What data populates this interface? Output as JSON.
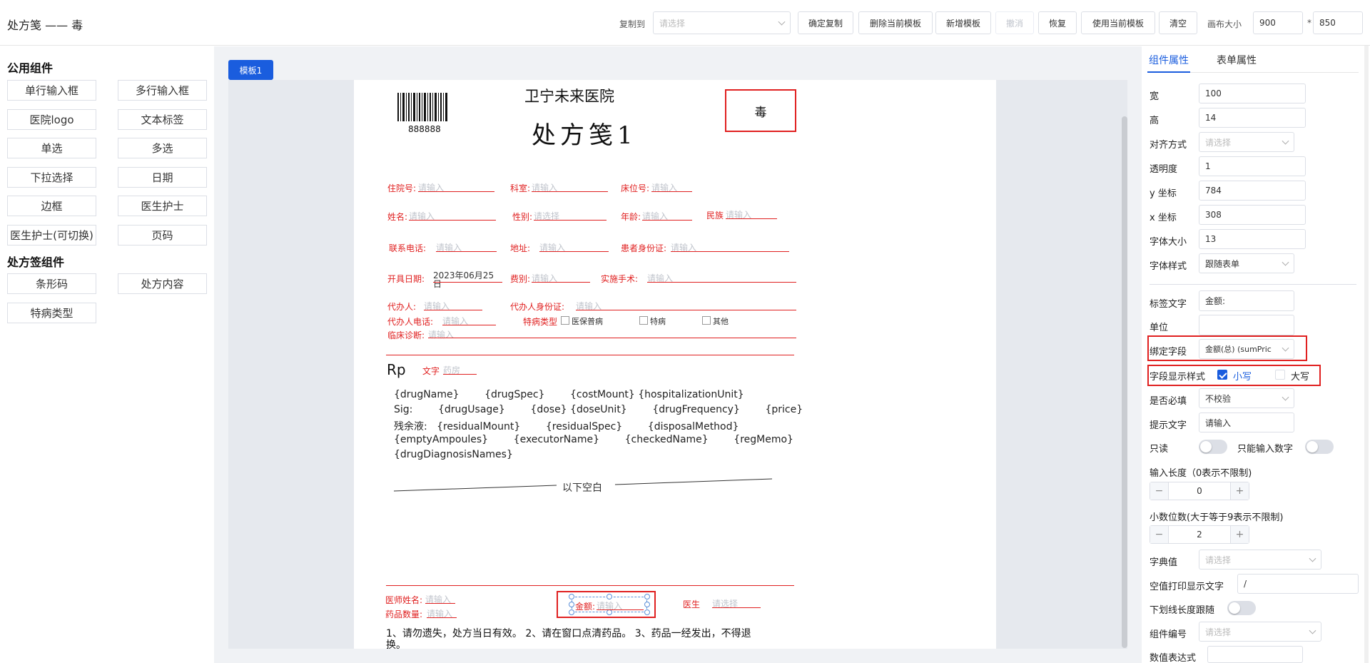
{
  "header": {
    "title": "处方笺 —— 毒",
    "copy_to_label": "复制到",
    "copy_to_placeholder": "请选择",
    "buttons": {
      "confirm_copy": "确定复制",
      "delete_template": "删除当前模板",
      "add_template": "新增模板",
      "undo": "撤消",
      "redo": "恢复",
      "use_template": "使用当前模板",
      "clear": "清空"
    },
    "canvas_size_label": "画布大小",
    "canvas_width": "900",
    "canvas_times": "*",
    "canvas_height": "850"
  },
  "left": {
    "public_title": "公用组件",
    "public_items": [
      "单行输入框",
      "多行输入框",
      "医院logo",
      "文本标签",
      "单选",
      "多选",
      "下拉选择",
      "日期",
      "边框",
      "医生护士",
      "医生护士(可切换)",
      "页码"
    ],
    "rx_title": "处方签组件",
    "rx_items": [
      "条形码",
      "处方内容",
      "特病类型"
    ]
  },
  "center": {
    "template_tab": "模板1",
    "hospital": "卫宁未来医院",
    "rx_title": "处方笺1",
    "barcode_number": "888888",
    "poison_label": "毒",
    "placeholder": "请输入",
    "select_placeholder": "请选择",
    "fields": {
      "inpatient_no": "住院号:",
      "department": "科室:",
      "bed_no": "床位号:",
      "name": "姓名:",
      "gender": "性别:",
      "age": "年龄:",
      "ethnicity": "民族",
      "phone": "联系电话:",
      "address": "地址:",
      "id_card": "患者身份证:",
      "open_date": "开具日期:",
      "open_date_value": "2023年06月25日",
      "fee_type": "费别:",
      "surgery": "实施手术:",
      "agent": "代办人:",
      "agent_id": "代办人身份证:",
      "agent_phone": "代办人电话:",
      "disease_type": "特病类型",
      "diagnosis": "临床诊断:",
      "rp": "Rp",
      "text_label": "文字",
      "text_value": "药房",
      "doctor_name": "医师姓名:",
      "drug_qty": "药品数量:",
      "amount": "金额:",
      "doctor": "医生"
    },
    "disease_options": [
      "医保普病",
      "特病",
      "其他"
    ],
    "rx_lines": [
      "{drugName}        {drugSpec}        {costMount} {hospitalizationUnit}",
      "Sig:        {drugUsage}        {dose} {doseUnit}        {drugFrequency}        {price}",
      "残余液:   {residualMount}        {residualSpec}        {disposalMethod}",
      "{emptyAmpoules}        {executorName}        {checkedName}        {regMemo}",
      "{drugDiagnosisNames}"
    ],
    "blank_text": "以下空白",
    "notice_line1": "1、请勿遗失，处方当日有效。 2、请在窗口点清药品。 3、药品一经发出，不得退",
    "notice_line2": "换。"
  },
  "right": {
    "tabs": [
      "组件属性",
      "表单属性"
    ],
    "labels": {
      "width": "宽",
      "height": "高",
      "align": "对齐方式",
      "opacity": "透明度",
      "y": "y 坐标",
      "x": "x 坐标",
      "font_size": "字体大小",
      "font_style": "字体样式",
      "label_text": "标签文字",
      "unit": "单位",
      "bind_field": "绑定字段",
      "display_style": "字段显示样式",
      "required": "是否必填",
      "hint": "提示文字",
      "readonly": "只读",
      "numeric_only": "只能输入数字",
      "input_length": "输入长度（0表示不限制)",
      "decimals": "小数位数(大于等于9表示不限制)",
      "dict": "字典值",
      "empty_print": "空值打印显示文字",
      "underline_follow": "下划线长度跟随",
      "component_no": "组件编号",
      "value_expr": "数值表达式"
    },
    "values": {
      "width": "100",
      "height": "14",
      "align_placeholder": "请选择",
      "opacity": "1",
      "y": "784",
      "x": "308",
      "font_size": "13",
      "font_style": "跟随表单",
      "label_text": "金额:",
      "unit": "",
      "bind_field": "金额(总) (sumPric",
      "style_lower": "小写",
      "style_upper": "大写",
      "required": "不校验",
      "hint": "请输入",
      "input_length": "0",
      "decimals": "2",
      "dict_placeholder": "请选择",
      "empty_print": "/",
      "component_no_placeholder": "请选择"
    },
    "stepper_minus": "−",
    "stepper_plus": "+"
  }
}
